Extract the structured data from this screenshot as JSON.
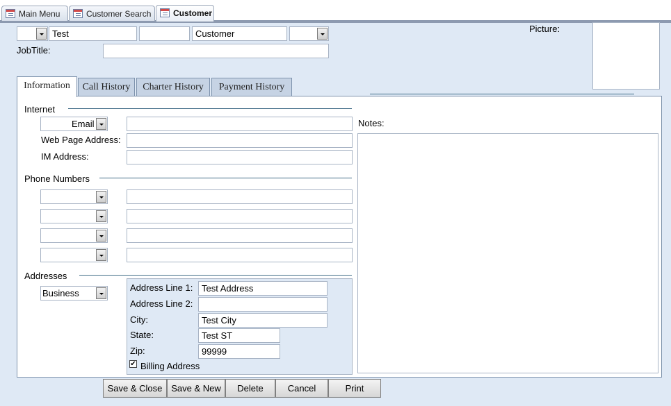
{
  "document_tabs": [
    "Main Menu",
    "Customer Search",
    "Customer"
  ],
  "header": {
    "title_combo_value": "",
    "first_name": "Test",
    "middle_name": "",
    "last_name": "Customer",
    "suffix_combo_value": "",
    "picture_label": "Picture:",
    "jobtitle_label": "JobTitle:",
    "jobtitle_value": ""
  },
  "page_tabs": [
    "Information",
    "Call History",
    "Charter History",
    "Payment History"
  ],
  "internet": {
    "section_label": "Internet",
    "email_type": "Email",
    "email_value": "",
    "web_label": "Web Page Address:",
    "web_value": "",
    "im_label": "IM Address:",
    "im_value": ""
  },
  "notes": {
    "label": "Notes:",
    "value": ""
  },
  "phones": {
    "section_label": "Phone Numbers",
    "rows": [
      {
        "type": "",
        "number": ""
      },
      {
        "type": "",
        "number": ""
      },
      {
        "type": "",
        "number": ""
      },
      {
        "type": "",
        "number": ""
      }
    ]
  },
  "addresses": {
    "section_label": "Addresses",
    "type": "Business",
    "line1_label": "Address Line 1:",
    "line1_value": "Test Address",
    "line2_label": "Address Line 2:",
    "line2_value": "",
    "city_label": "City:",
    "city_value": "Test City",
    "state_label": "State:",
    "state_value": "Test ST",
    "zip_label": "Zip:",
    "zip_value": "99999",
    "billing_label": "Billing Address",
    "billing_checked": true
  },
  "buttons": [
    "Save & Close",
    "Save & New",
    "Delete",
    "Cancel",
    "Print"
  ],
  "colors": {
    "form_background": "#dfe9f5",
    "tab_inactive": "#c6d3e4",
    "section_rule": "#3f6b86"
  }
}
